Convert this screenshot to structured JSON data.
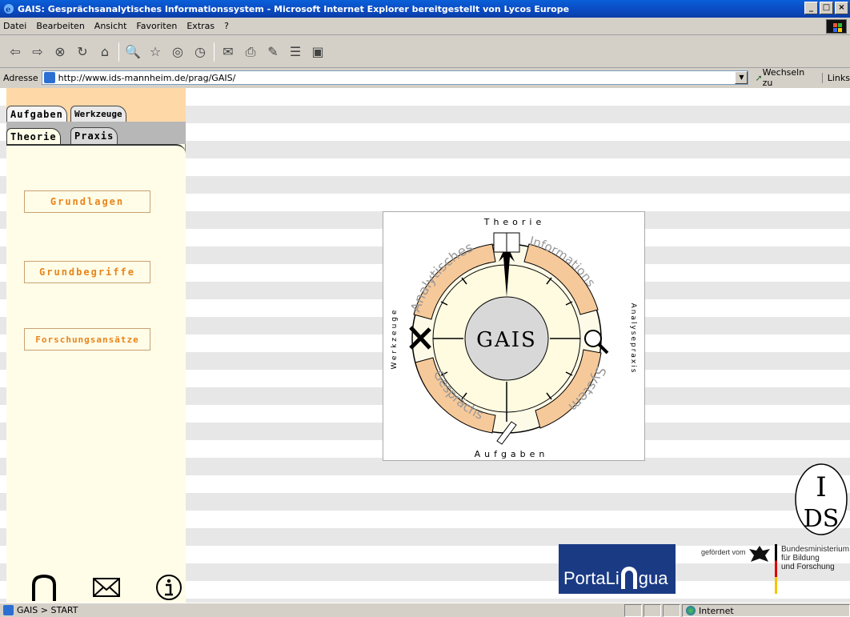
{
  "window": {
    "title": "GAIS: Gesprächsanalytisches Informationssystem - Microsoft Internet Explorer bereitgestellt von Lycos Europe",
    "buttons": [
      "_",
      "□",
      "×"
    ]
  },
  "menu": {
    "items": [
      "Datei",
      "Bearbeiten",
      "Ansicht",
      "Favoriten",
      "Extras",
      "?"
    ]
  },
  "address": {
    "label": "Adresse",
    "url": "http://www.ids-mannheim.de/prag/GAIS/",
    "go_label": "Wechseln zu",
    "links_label": "Links"
  },
  "tabs": {
    "row1": [
      "Aufgaben",
      "Werkzeuge"
    ],
    "row2": [
      "Theorie",
      "Praxis"
    ]
  },
  "nav": {
    "buttons": [
      "Grundlagen",
      "Grundbegriffe",
      "Forschungsansätze"
    ]
  },
  "logo": {
    "center": "GAIS",
    "top": "Theorie",
    "bottom": "Aufgaben",
    "left": "Werkzeuge",
    "right": "Analysepraxis",
    "arc_words": [
      "Analytisches",
      "Informations",
      "System",
      "Gesprächs"
    ]
  },
  "footer": {
    "portalingua": "PortaLi  gua",
    "portal_left": "PortaLi",
    "portal_right": "gua",
    "gefoerdert": "gefördert vom",
    "bmbf_lines": [
      "Bundesministerium",
      "für Bildung",
      "und Forschung"
    ],
    "ids": "IDS"
  },
  "status": {
    "text": "GAIS > START",
    "zone": "Internet"
  },
  "colors": {
    "accent": "#e8841a",
    "tab_bg": "#ffd8a8",
    "panel_bg": "#fffde8"
  }
}
